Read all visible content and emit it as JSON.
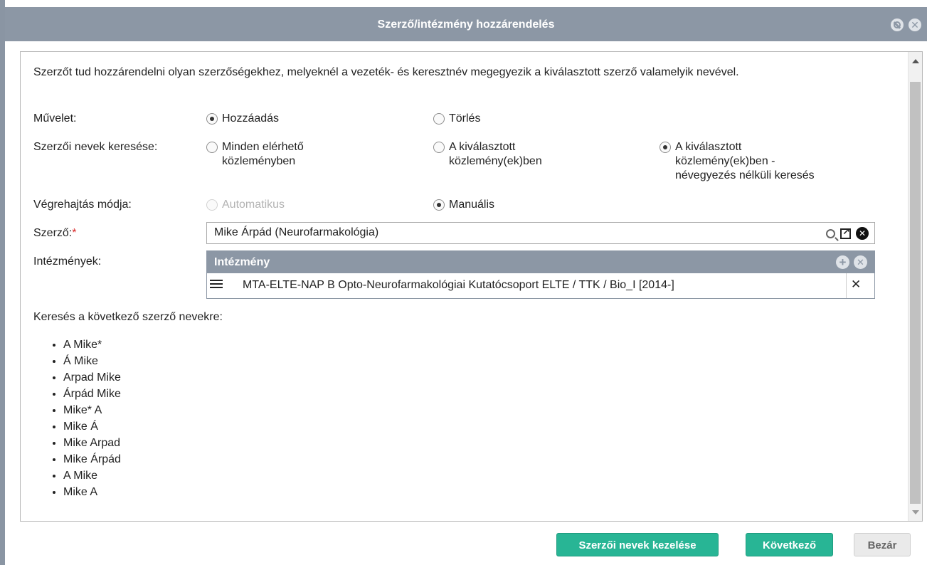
{
  "dialog": {
    "title": "Szerző/intézmény hozzárendelés"
  },
  "intro": "Szerzőt tud hozzárendelni olyan szerzőségekhez, melyeknél a vezeték- és keresztnév megegyezik a kiválasztott szerző valamelyik nevével.",
  "operation": {
    "label": "Művelet:",
    "options": [
      {
        "label": "Hozzáadás",
        "selected": true
      },
      {
        "label": "Törlés",
        "selected": false
      }
    ]
  },
  "name_search": {
    "label": "Szerzői nevek keresése:",
    "options": [
      {
        "line1": "Minden elérhető",
        "line2": "közleményben",
        "line3": "",
        "selected": false
      },
      {
        "line1": "A kiválasztott",
        "line2": "közlemény(ek)ben",
        "line3": "",
        "selected": false
      },
      {
        "line1": "A kiválasztott",
        "line2": "közlemény(ek)ben -",
        "line3": "névegyezés nélküli keresés",
        "selected": true
      }
    ]
  },
  "execution_mode": {
    "label": "Végrehajtás módja:",
    "options": [
      {
        "label": "Automatikus",
        "selected": false,
        "disabled": true
      },
      {
        "label": "Manuális",
        "selected": true,
        "disabled": false
      }
    ]
  },
  "author": {
    "label": "Szerző:",
    "required_mark": "*",
    "value": "Mike Árpád (Neurofarmakológia)"
  },
  "institutions": {
    "label": "Intézmények:",
    "column_header": "Intézmény",
    "rows": [
      {
        "name": "MTA-ELTE-NAP B Opto-Neurofarmakológiai Kutatócsoport ELTE / TTK / Bio_I [2014-]",
        "remove": "✕"
      }
    ]
  },
  "search_names": {
    "title": "Keresés a következő szerző nevekre:",
    "names": [
      "A Mike*",
      "Á Mike",
      "Arpad Mike",
      "Árpád Mike",
      "Mike* A",
      "Mike Á",
      "Mike Arpad",
      "Mike Árpád",
      "A Mike",
      "Mike A"
    ]
  },
  "buttons": {
    "manage_names": "Szerzői nevek kezelése",
    "next": "Következő",
    "close": "Bezár"
  },
  "colors": {
    "titlebar": "#8c97a5",
    "primary_button": "#28b595",
    "required": "#d92626"
  }
}
